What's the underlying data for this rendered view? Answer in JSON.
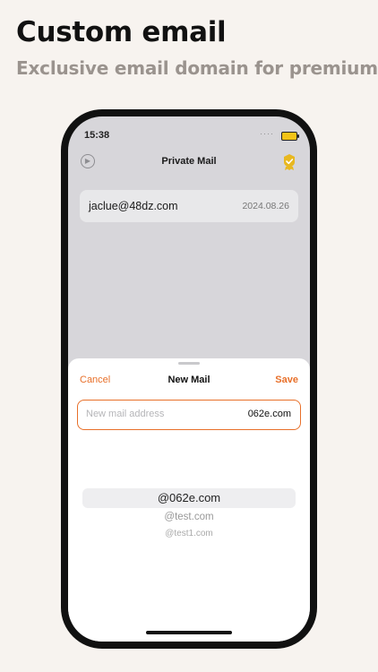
{
  "promo": {
    "headline": "Custom email",
    "subheadline": "Exclusive email domain for premium"
  },
  "status_bar": {
    "time": "15:38",
    "signal": "····",
    "battery_icon": "battery-charging-icon"
  },
  "navbar": {
    "title": "Private Mail",
    "left_icon": "play-circle-icon",
    "right_icon": "premium-badge-icon",
    "accent_color": "#e8b820"
  },
  "mail_list": [
    {
      "address": "jaclue@48dz.com",
      "date": "2024.08.26"
    }
  ],
  "sheet": {
    "cancel_label": "Cancel",
    "title": "New Mail",
    "save_label": "Save",
    "accent_color": "#e8702a",
    "input": {
      "placeholder": "New mail address",
      "value": "",
      "domain": "062e.com"
    },
    "domain_options": [
      "@062e.com",
      "@test.com",
      "@test1.com"
    ],
    "selected_domain": "@062e.com"
  }
}
